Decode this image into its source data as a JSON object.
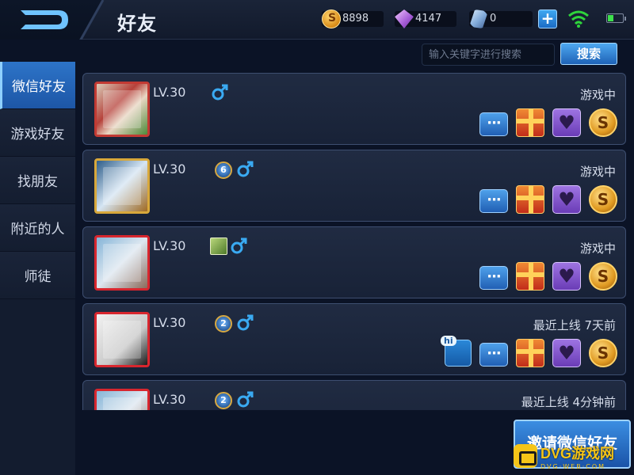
{
  "header": {
    "title": "好友",
    "currencies": [
      {
        "name": "gold-coin",
        "value": "8898"
      },
      {
        "name": "diamond",
        "value": "4147"
      },
      {
        "name": "crystal",
        "value": "0"
      }
    ],
    "plus_label": "+"
  },
  "sidebar": {
    "items": [
      {
        "label": "微信好友",
        "active": true
      },
      {
        "label": "游戏好友"
      },
      {
        "label": "找朋友"
      },
      {
        "label": "附近的人"
      },
      {
        "label": "师徒"
      }
    ]
  },
  "search": {
    "placeholder": "输入关键字进行搜索",
    "button_label": "搜索"
  },
  "friends": [
    {
      "level": "LV.30",
      "rank_badge": "",
      "status": "游戏中",
      "frame": "frame-xmas",
      "has_hi": false
    },
    {
      "level": "LV.30",
      "rank_badge": "6",
      "status": "游戏中",
      "frame": "frame-gold",
      "has_hi": false
    },
    {
      "level": "LV.30",
      "rank_badge": "",
      "status": "游戏中",
      "frame": "frame-red",
      "has_hi": false
    },
    {
      "level": "LV.30",
      "rank_badge": "2",
      "status": "最近上线  7天前",
      "frame": "frame-red2",
      "has_hi": true,
      "hi_label": "hi"
    },
    {
      "level": "LV.30",
      "rank_badge": "2",
      "status": "最近上线  4分钟前",
      "frame": "frame-red",
      "has_hi": false
    }
  ],
  "invite": {
    "label": "邀请微信好友"
  },
  "watermark": {
    "main": "DVG游戏网",
    "sub": "DVG·WEB·COM"
  },
  "colors": {
    "accent": "#2d74c8",
    "card_bg": "#1c2640",
    "gold": "#d8a83b"
  }
}
